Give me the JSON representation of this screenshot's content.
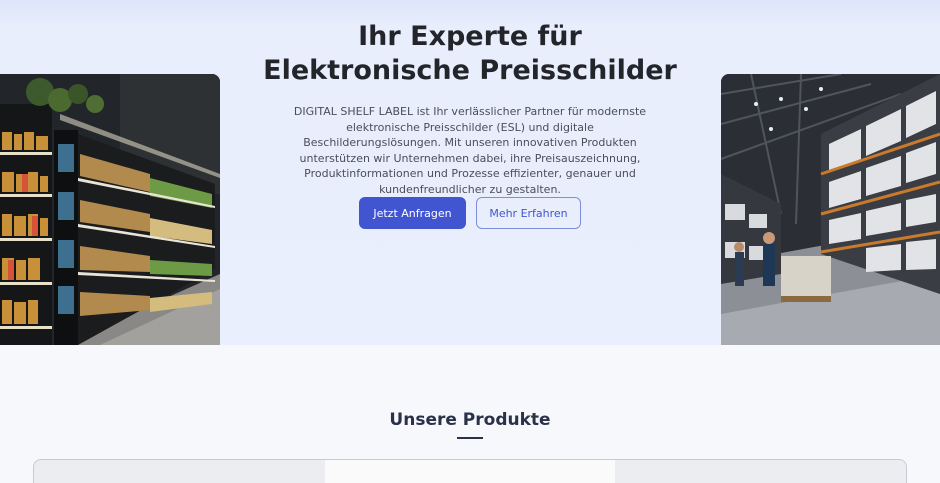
{
  "hero": {
    "title_line1": "Ihr Experte für",
    "title_line2": "Elektronische Preisschilder",
    "description": "DIGITAL SHELF LABEL ist Ihr verlässlicher Partner für modernste elektronische Preisschilder (ESL) und digitale Beschilderungslösungen. Mit unseren innovativen Produkten unterstützen wir Unternehmen dabei, ihre Preisauszeichnung, Produktinformationen und Prozesse effizienter, genauer und kundenfreundlicher zu gestalten.",
    "primary_button": "Jetzt Anfragen",
    "secondary_button": "Mehr Erfahren"
  },
  "products": {
    "title": "Unsere Produkte"
  },
  "colors": {
    "accent": "#4055cf",
    "heading": "#23252b",
    "section_heading": "#2a3148"
  }
}
